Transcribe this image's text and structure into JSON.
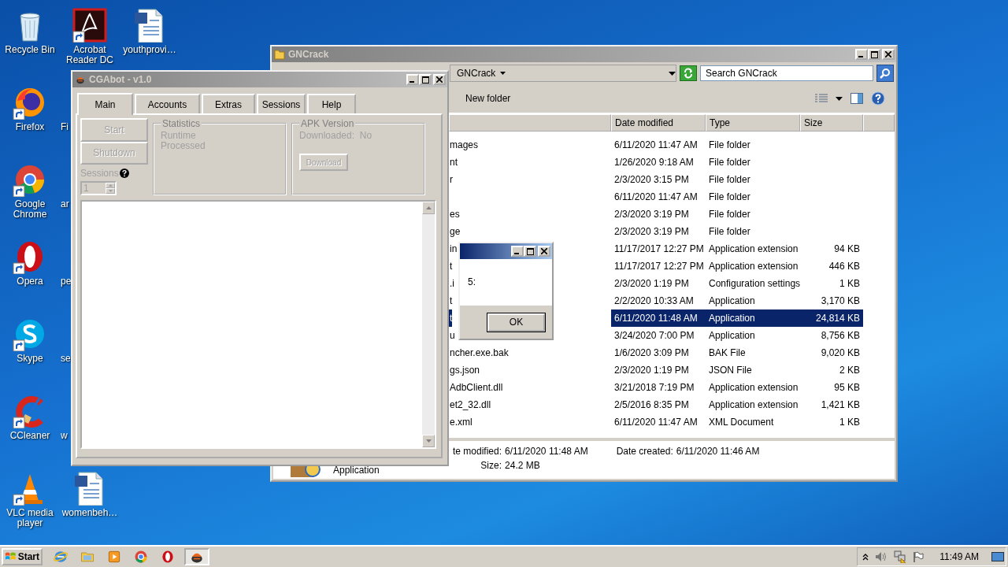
{
  "desktop_icons": [
    {
      "label": "Recycle Bin",
      "kind": "recycle-bin",
      "shortcut": false
    },
    {
      "label": "Firefox",
      "kind": "firefox",
      "shortcut": true
    },
    {
      "label": "Google Chrome",
      "kind": "chrome",
      "shortcut": true
    },
    {
      "label": "Opera",
      "kind": "opera",
      "shortcut": true
    },
    {
      "label": "Skype",
      "kind": "skype",
      "shortcut": true
    },
    {
      "label": "CCleaner",
      "kind": "ccleaner",
      "shortcut": true
    },
    {
      "label": "VLC media player",
      "kind": "vlc",
      "shortcut": true
    },
    {
      "label": "Acrobat Reader DC",
      "kind": "acrobat",
      "shortcut": true
    },
    {
      "label": "Fi",
      "kind": "covered"
    },
    {
      "label": "ar",
      "kind": "covered"
    },
    {
      "label": "pe",
      "kind": "covered"
    },
    {
      "label": "se",
      "kind": "covered"
    },
    {
      "label": "w",
      "kind": "covered"
    },
    {
      "label": "womenbeh…",
      "kind": "word",
      "shortcut": false
    },
    {
      "label": "youthprovi…",
      "kind": "word",
      "shortcut": false
    }
  ],
  "explorer": {
    "title": "GNCrack",
    "active": false,
    "breadcrumb": "GNCrack",
    "search": {
      "placeholder": "Search GNCrack"
    },
    "toolbar": [
      "New folder"
    ],
    "columns": [
      "Date modified",
      "Type",
      "Size"
    ],
    "rows": [
      {
        "name": "mages",
        "date": "6/11/2020 11:47 AM",
        "type": "File folder",
        "selected": false
      },
      {
        "name": "nt",
        "date": "1/26/2020 9:18 AM",
        "type": "File folder",
        "selected": false
      },
      {
        "name": "r",
        "date": "2/3/2020 3:15 PM",
        "type": "File folder",
        "selected": false
      },
      {
        "date": "6/11/2020 11:47 AM",
        "type": "File folder",
        "selected": false
      },
      {
        "name": "es",
        "date": "2/3/2020 3:19 PM",
        "type": "File folder",
        "selected": false
      },
      {
        "name": "ge",
        "date": "2/3/2020 3:19 PM",
        "type": "File folder",
        "selected": false
      },
      {
        "name": "in",
        "date": "11/17/2017 12:27 PM",
        "type": "Application extension",
        "size": "94 KB",
        "selected": false
      },
      {
        "name": "t",
        "date": "11/17/2017 12:27 PM",
        "type": "Application extension",
        "size": "446 KB",
        "selected": false
      },
      {
        "name": ".i",
        "date": "2/3/2020 1:19 PM",
        "type": "Configuration settings",
        "size": "1 KB",
        "selected": false
      },
      {
        "name": "t",
        "date": "2/2/2020 10:33 AM",
        "type": "Application",
        "size": "3,170 KB",
        "selected": false
      },
      {
        "name": "t",
        "date": "6/11/2020 11:48 AM",
        "type": "Application",
        "size": "24,814 KB",
        "selected": true
      },
      {
        "name": "u",
        "date": "3/24/2020 7:00 PM",
        "type": "Application",
        "size": "8,756 KB",
        "selected": false
      },
      {
        "name": "ncher.exe.bak",
        "date": "1/6/2020 3:09 PM",
        "type": "BAK File",
        "size": "9,020 KB",
        "selected": false
      },
      {
        "name": "gs.json",
        "date": "2/3/2020 1:19 PM",
        "type": "JSON File",
        "size": "2 KB",
        "selected": false
      },
      {
        "name": "AdbClient.dll",
        "date": "3/21/2018 7:19 PM",
        "type": "Application extension",
        "size": "95 KB",
        "selected": false
      },
      {
        "name": "et2_32.dll",
        "date": "2/5/2016 8:35 PM",
        "type": "Application extension",
        "size": "1,421 KB",
        "selected": false
      },
      {
        "name": "e.xml",
        "date": "6/11/2020 11:47 AM",
        "type": "XML Document",
        "size": "1 KB",
        "selected": false
      }
    ],
    "details": {
      "type": "Application",
      "fields": [
        {
          "label": "te modified:",
          "value": "6/11/2020 11:48 AM"
        },
        {
          "label": "Date created:",
          "value": "6/11/2020 11:46 AM"
        },
        {
          "label": "Size:",
          "value": "24.2 MB"
        }
      ]
    }
  },
  "cgabot": {
    "title": "CGAbot - v1.0",
    "active": false,
    "tabs": [
      {
        "label": "Main",
        "selected": true
      },
      {
        "label": "Accounts",
        "selected": false
      },
      {
        "label": "Extras",
        "selected": false
      },
      {
        "label": "Sessions",
        "selected": false
      },
      {
        "label": "Help",
        "selected": false
      }
    ],
    "buttons": [
      {
        "label": "Start",
        "disabled": true
      },
      {
        "label": "Shutdown",
        "disabled": true
      }
    ],
    "sessions": {
      "label": "Sessions",
      "value": "1",
      "disabled": true
    },
    "statistics": {
      "title": "Statistics",
      "items": [
        "Runtime",
        "Processed"
      ]
    },
    "apk": {
      "title": "APK Version",
      "status_label": "Downloaded:",
      "status_value": "No",
      "button": {
        "label": "Download",
        "disabled": true
      }
    }
  },
  "dialog": {
    "active": true,
    "message": "5:",
    "button": "OK"
  },
  "taskbar": {
    "start": "Start",
    "apps": [
      {
        "kind": "ie",
        "pressed": false
      },
      {
        "kind": "folder",
        "pressed": false
      },
      {
        "kind": "media",
        "pressed": false
      },
      {
        "kind": "chrome",
        "pressed": false
      },
      {
        "kind": "opera",
        "pressed": false
      },
      {
        "kind": "cgabot",
        "pressed": true
      }
    ],
    "clock": "11:49 AM"
  }
}
